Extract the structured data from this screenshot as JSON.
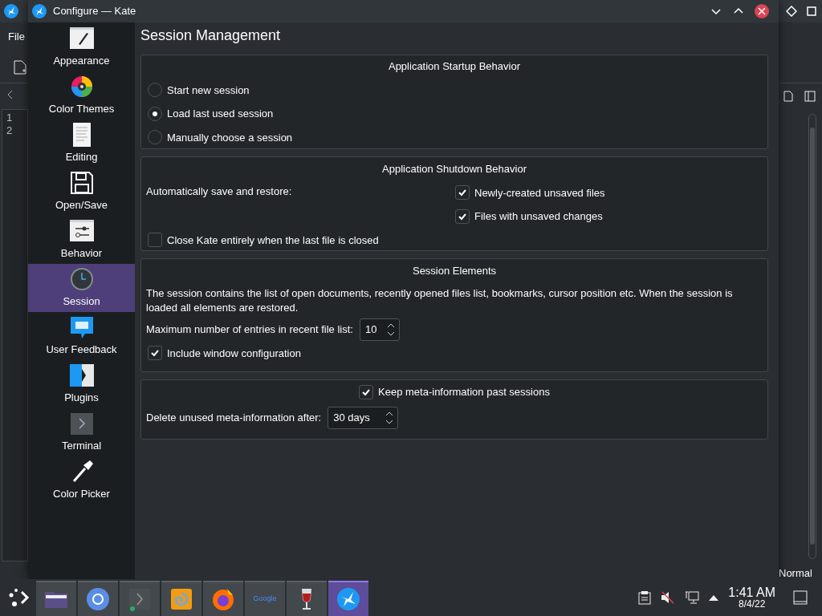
{
  "background_window": {
    "menu": [
      "File"
    ],
    "line_numbers": [
      "1",
      "2"
    ],
    "status": "Normal"
  },
  "dialog": {
    "title": "Configure — Kate"
  },
  "sidebar": {
    "items": [
      {
        "label": "Appearance",
        "kind": "appearance",
        "selected": false
      },
      {
        "label": "Color Themes",
        "kind": "colors",
        "selected": false
      },
      {
        "label": "Editing",
        "kind": "editing",
        "selected": false
      },
      {
        "label": "Open/Save",
        "kind": "save",
        "selected": false
      },
      {
        "label": "Behavior",
        "kind": "behavior",
        "selected": false
      },
      {
        "label": "Session",
        "kind": "session",
        "selected": true
      },
      {
        "label": "User Feedback",
        "kind": "feedback",
        "selected": false
      },
      {
        "label": "Plugins",
        "kind": "plugins",
        "selected": false
      },
      {
        "label": "Terminal",
        "kind": "terminal",
        "selected": false
      },
      {
        "label": "Color Picker",
        "kind": "picker",
        "selected": false
      }
    ]
  },
  "page": {
    "title": "Session Management",
    "startup": {
      "title": "Application Startup Behavior",
      "options": [
        {
          "label": "Start new session",
          "selected": false
        },
        {
          "label": "Load last used session",
          "selected": true
        },
        {
          "label": "Manually choose a session",
          "selected": false
        }
      ]
    },
    "shutdown": {
      "title": "Application Shutdown Behavior",
      "label": "Automatically save and restore:",
      "options": [
        {
          "label": "Newly-created unsaved files",
          "checked": true
        },
        {
          "label": "Files with unsaved changes",
          "checked": true
        }
      ],
      "close_option": {
        "label": "Close Kate entirely when the last file is closed",
        "checked": false
      }
    },
    "elements": {
      "title": "Session Elements",
      "description": "The session contains the list of open documents, recently opened files list, bookmarks, cursor position etc. When the session is loaded all elements are restored.",
      "max_entries": {
        "label": "Maximum number of entries in recent file list:",
        "value": "10"
      },
      "include_window": {
        "label": "Include window configuration",
        "checked": true
      }
    },
    "meta": {
      "keep": {
        "label": "Keep meta-information past sessions",
        "checked": true
      },
      "delete_after": {
        "label": "Delete unused meta-information after:",
        "value": "30 days"
      }
    }
  },
  "taskbar": {
    "apps": [
      {
        "kind": "folder",
        "selected": false
      },
      {
        "kind": "chromium",
        "selected": false
      },
      {
        "kind": "terminal",
        "selected": false
      },
      {
        "kind": "swirl",
        "selected": false
      },
      {
        "kind": "firefox",
        "selected": false
      },
      {
        "kind": "google",
        "label": "Google",
        "selected": false
      },
      {
        "kind": "wine",
        "selected": false
      },
      {
        "kind": "kate",
        "selected": true
      }
    ],
    "clock": {
      "time": "1:41 AM",
      "date": "8/4/22"
    }
  }
}
